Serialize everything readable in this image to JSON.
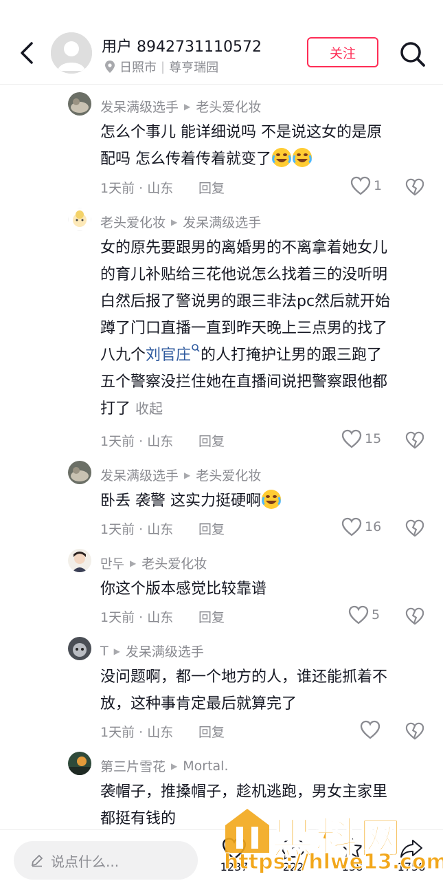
{
  "header": {
    "username": "用户 8942731110572",
    "location": "日照市",
    "location_sep": "|",
    "place": "尊亨瑞园",
    "follow_label": "关注"
  },
  "comments": [
    {
      "author": "发呆满级选手",
      "reply_to": "老头爱化妆",
      "lines": [
        "怎么个事儿  能详细说吗  不是说这女的是原",
        "配吗  怎么传着传着就变了"
      ],
      "meta": "1天前 · 山东",
      "reply_label": "回复",
      "likes": "1"
    },
    {
      "author": "老头爱化妆",
      "reply_to": "发呆满级选手",
      "lines": [
        "女的原先要跟男的离婚男的不离拿着她女儿",
        "的育儿补贴给三花他说怎么找着三的没听明",
        "白然后报了警说男的跟三非法pc然后就开始",
        "蹲了门口直播一直到昨天晚上三点男的找了"
      ],
      "line5_before": "八九个",
      "line5_link": "刘官庄",
      "line5_after": "的人打掩护让男的跟三跑了",
      "line6": "五个警察没拦住她在直播间说把警察跟他都",
      "line7": "打了",
      "collapse_label": "收起",
      "meta": "1天前 · 山东",
      "reply_label": "回复",
      "likes": "15"
    },
    {
      "author": "发呆满级选手",
      "reply_to": "老头爱化妆",
      "text": "卧丢 袭警 这实力挺硬啊",
      "meta": "1天前 · 山东",
      "reply_label": "回复",
      "likes": "16"
    },
    {
      "author": "만두",
      "reply_to": "老头爱化妆",
      "text": "你这个版本感觉比较靠谱",
      "meta": "1天前 · 山东",
      "reply_label": "回复",
      "likes": "5"
    },
    {
      "author": "T",
      "reply_to": "发呆满级选手",
      "lines": [
        "没问题啊，都一个地方的人，谁还能抓着不",
        "放，这种事肯定最后就算完了"
      ],
      "meta": "1天前 · 山东",
      "reply_label": "回复",
      "likes": ""
    },
    {
      "author": "第三片雪花",
      "reply_to": "Mortal.",
      "lines": [
        "袭帽子，推搡帽子，趁机逃跑，男女主家里",
        "都挺有钱的"
      ]
    }
  ],
  "bottom": {
    "input_placeholder": "说点什么...",
    "like_count": "1237",
    "comment_count": "222",
    "star_count": "138",
    "share_count": "1758"
  },
  "watermark": {
    "title": "黑料网",
    "url": "https://hlwe13.com"
  },
  "colors": {
    "accent": "#fe2c55",
    "muted": "#8a8b91",
    "link": "#2f5a9e",
    "watermark": "#f2a71b"
  }
}
